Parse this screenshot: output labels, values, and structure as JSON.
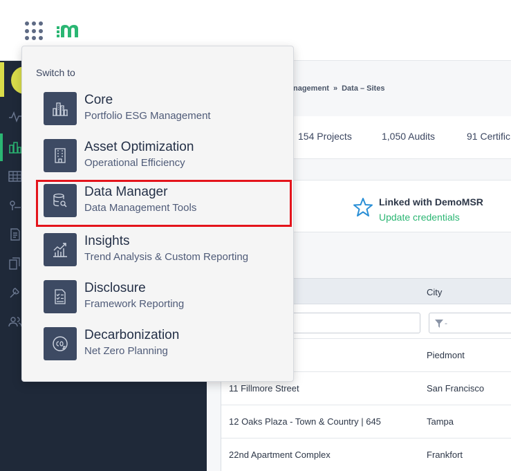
{
  "breadcrumb": {
    "parent": "nagement",
    "separator": "»",
    "current": "Data – Sites"
  },
  "stats": [
    {
      "label": "154 Projects"
    },
    {
      "label": "1,050 Audits"
    },
    {
      "label": "91 Certific"
    }
  ],
  "linked": {
    "title": "Linked with DemoMSR",
    "link": "Update credentials"
  },
  "table": {
    "city_header": "City",
    "filter_placeholder": "-",
    "rows": [
      {
        "name": "",
        "city": "Piedmont"
      },
      {
        "name": "11 Fillmore Street",
        "city": "San Francisco"
      },
      {
        "name": "12 Oaks Plaza - Town & Country | 645",
        "city": "Tampa"
      },
      {
        "name": "22nd Apartment Complex",
        "city": "Frankfort"
      }
    ]
  },
  "switcher": {
    "label": "Switch to",
    "apps": [
      {
        "title": "Core",
        "subtitle": "Portfolio ESG Management",
        "icon": "city-buildings-icon"
      },
      {
        "title": "Asset Optimization",
        "subtitle": "Operational Efficiency",
        "icon": "office-building-icon"
      },
      {
        "title": "Data Manager",
        "subtitle": "Data Management Tools",
        "icon": "database-search-icon"
      },
      {
        "title": "Insights",
        "subtitle": "Trend Analysis & Custom Reporting",
        "icon": "trend-chart-icon"
      },
      {
        "title": "Disclosure",
        "subtitle": "Framework Reporting",
        "icon": "checklist-document-icon"
      },
      {
        "title": "Decarbonization",
        "subtitle": "Net Zero Planning",
        "icon": "co2-icon"
      }
    ]
  },
  "colors": {
    "accent_green": "#2bb673",
    "highlight_red": "#e4141b",
    "tile": "#3d4a63",
    "sidebar": "#1f2939"
  }
}
